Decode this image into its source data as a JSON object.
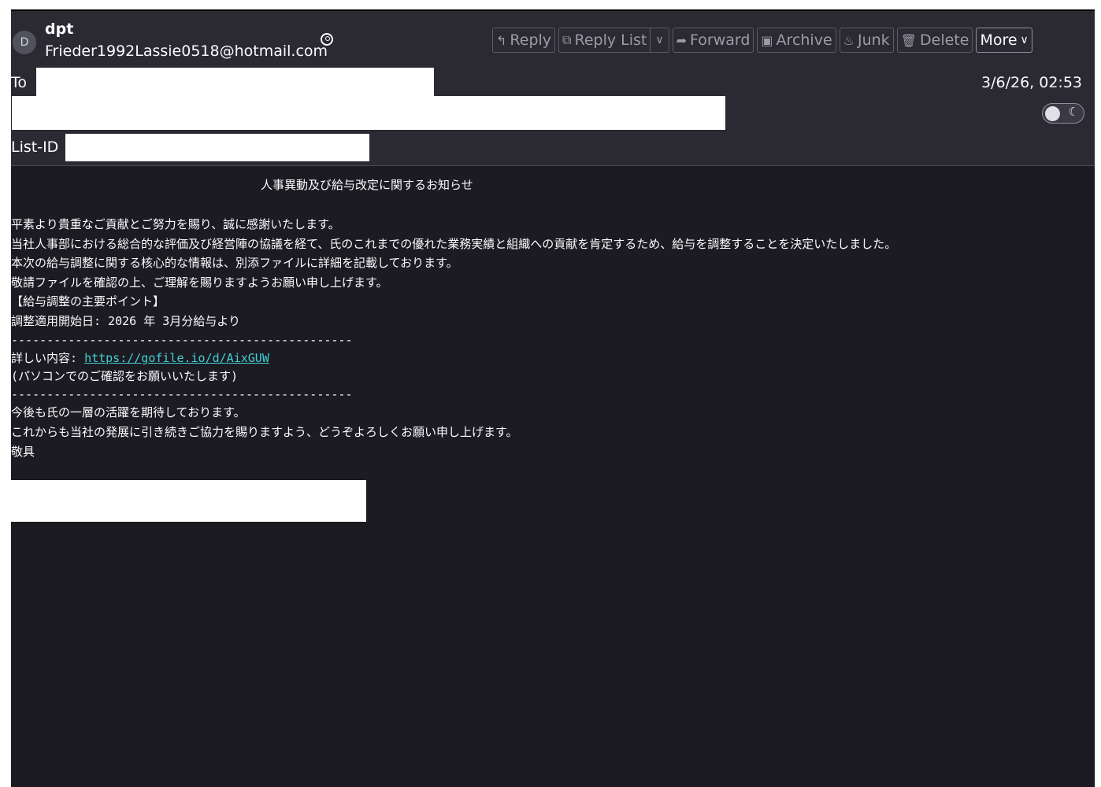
{
  "header": {
    "avatar_letter": "D",
    "sender_name": "dpt",
    "sender_email": "Frieder1992Lassie0518@hotmail.com",
    "to_label": "To",
    "list_id_label": "List-ID",
    "date": "3/6/26, 02:53"
  },
  "toolbar": {
    "reply": "Reply",
    "reply_list": "Reply List",
    "forward": "Forward",
    "archive": "Archive",
    "junk": "Junk",
    "delete": "Delete",
    "more": "More"
  },
  "icons": {
    "reply": "reply-arrow-icon",
    "reply_list": "reply-list-icon",
    "forward": "forward-arrow-icon",
    "archive": "archive-box-icon",
    "junk": "junk-flame-icon",
    "delete": "trash-icon",
    "more": "chevron-down-icon",
    "contact": "contact-icon",
    "theme": "moon-icon"
  },
  "colors": {
    "background": "#1c1b22",
    "header": "#2b2a33",
    "link": "#41d0d6"
  },
  "body": {
    "subject": "人事異動及び給与改定に関するお知らせ",
    "lines": [
      "平素より貴重なご貢献とご努力を賜り、誠に感謝いたします。",
      "当社人事部における総合的な評価及び経営陣の協議を経て、氏のこれまでの優れた業務実績と組織への貢献を肯定するため、給与を調整することを決定いたしました。",
      "本次の給与調整に関する核心的な情報は、別添ファイルに詳細を記載しております。",
      "敬請ファイルを確認の上、ご理解を賜りますようお願い申し上げます。",
      "【給与調整の主要ポイント】",
      "調整適用開始日: 2026 年 3月分給与より",
      "------------------------------------------------"
    ],
    "detail_label": "詳しい内容: ",
    "detail_link": "https://gofile.io/d/AixGUW",
    "pc_note": "(パソコンでのご確認をお願いいたします)",
    "divider": "------------------------------------------------",
    "closing": [
      "今後も氏の一層の活躍を期待しております。",
      "これからも当社の発展に引き続きご協力を賜りますよう、どうぞよろしくお願い申し上げます。",
      "敬具"
    ]
  }
}
